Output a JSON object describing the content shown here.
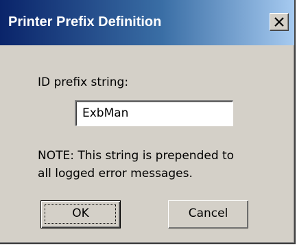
{
  "window": {
    "title": "Printer Prefix Definition",
    "close_icon": "close-icon"
  },
  "form": {
    "id_prefix_label": "ID prefix string:",
    "id_prefix_value": "ExbMan",
    "note_line1": "NOTE: This string is prepended to",
    "note_line2": "all logged error messages."
  },
  "buttons": {
    "ok_label": "OK",
    "cancel_label": "Cancel"
  },
  "colors": {
    "titlebar_start": "#0a246a",
    "titlebar_end": "#a6caf0",
    "dialog_face": "#d4d0c8"
  }
}
